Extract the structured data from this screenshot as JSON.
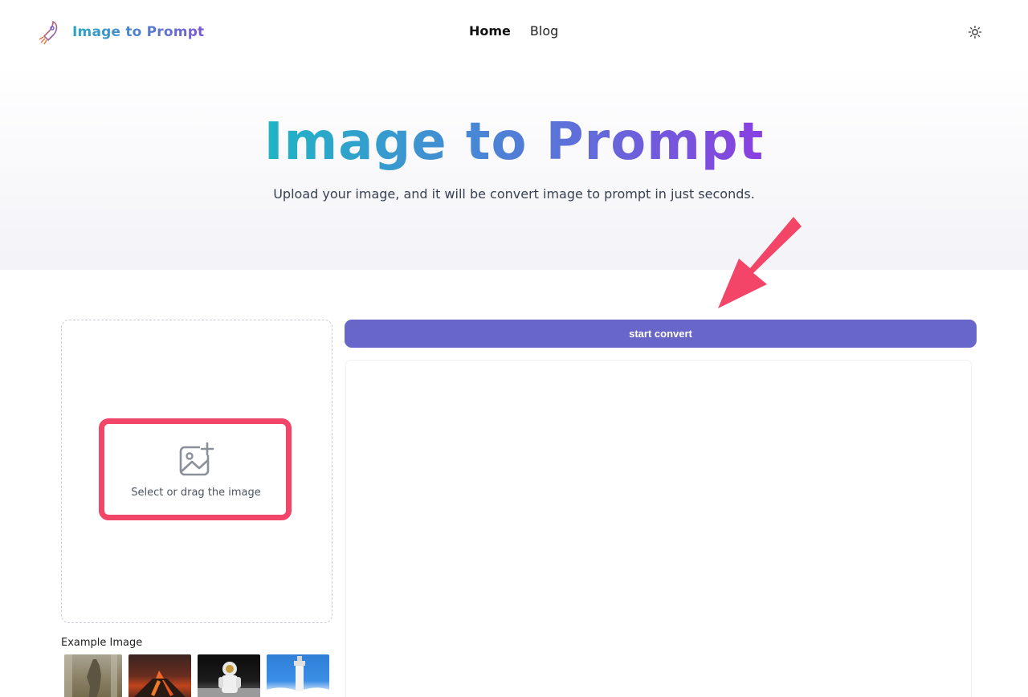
{
  "header": {
    "logo_text": "Image to Prompt",
    "nav": {
      "home": "Home",
      "blog": "Blog"
    }
  },
  "hero": {
    "title": "Image to Prompt",
    "subtitle": "Upload your image, and it will be convert image to prompt in just seconds."
  },
  "upload": {
    "text": "Select or drag the image"
  },
  "convert": {
    "button_label": "start convert"
  },
  "examples": {
    "label": "Example Image",
    "items": [
      "kangaroo-thumbnail",
      "volcano-thumbnail",
      "astronaut-thumbnail",
      "lighthouse-thumbnail"
    ]
  },
  "colors": {
    "brand_start": "#1fb5c4",
    "brand_end": "#8a3fe0",
    "button": "#6867c9",
    "highlight": "#f24567"
  }
}
